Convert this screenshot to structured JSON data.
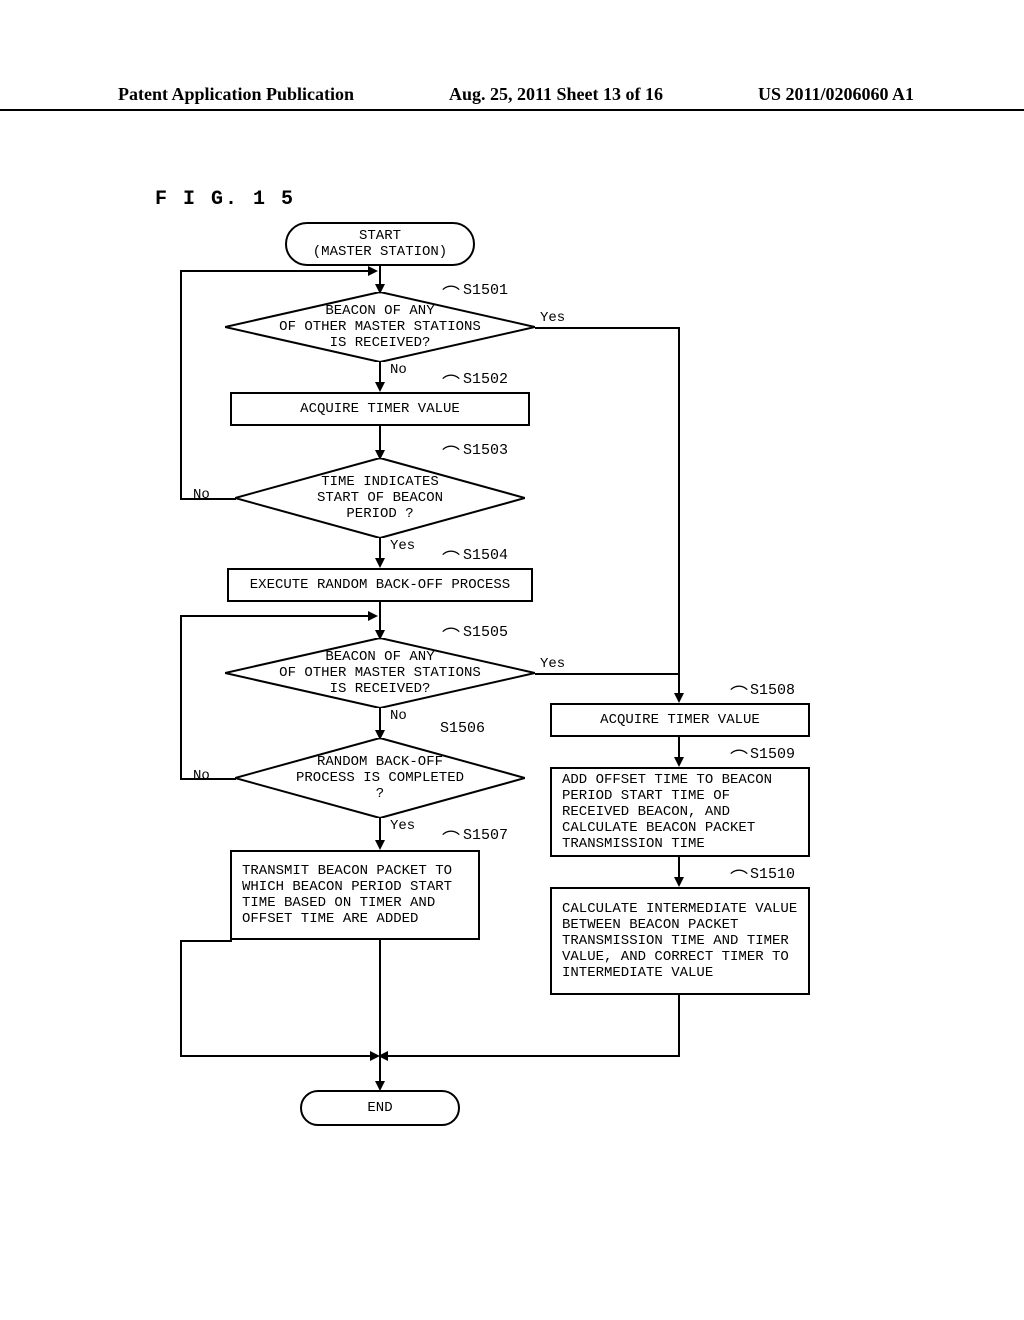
{
  "header": {
    "left": "Patent Application Publication",
    "center": "Aug. 25, 2011  Sheet 13 of 16",
    "right": "US 2011/0206060 A1"
  },
  "figure_title": "F I G.  1 5",
  "nodes": {
    "start": "START\n(MASTER STATION)",
    "s1501": "BEACON OF ANY\nOF OTHER MASTER STATIONS\nIS RECEIVED?",
    "s1502": "ACQUIRE TIMER VALUE",
    "s1503": "TIME INDICATES\nSTART OF BEACON\nPERIOD ?",
    "s1504": "EXECUTE RANDOM BACK-OFF PROCESS",
    "s1505": "BEACON OF ANY\nOF OTHER MASTER STATIONS\nIS RECEIVED?",
    "s1506": "RANDOM BACK-OFF\nPROCESS IS COMPLETED\n?",
    "s1507": "TRANSMIT BEACON PACKET TO WHICH BEACON PERIOD START TIME BASED ON TIMER AND OFFSET TIME ARE ADDED",
    "s1508": "ACQUIRE TIMER VALUE",
    "s1509": "ADD OFFSET TIME TO BEACON PERIOD START TIME OF RECEIVED BEACON, AND CALCULATE BEACON PACKET TRANSMISSION TIME",
    "s1510": "CALCULATE INTERMEDIATE VALUE BETWEEN BEACON PACKET TRANSMISSION TIME AND TIMER VALUE, AND CORRECT TIMER TO INTERMEDIATE VALUE",
    "end": "END"
  },
  "labels": {
    "yes": "Yes",
    "no": "No"
  },
  "step_labels": {
    "s1501": "S1501",
    "s1502": "S1502",
    "s1503": "S1503",
    "s1504": "S1504",
    "s1505": "S1505",
    "s1506": "S1506",
    "s1507": "S1507",
    "s1508": "S1508",
    "s1509": "S1509",
    "s1510": "S1510"
  }
}
